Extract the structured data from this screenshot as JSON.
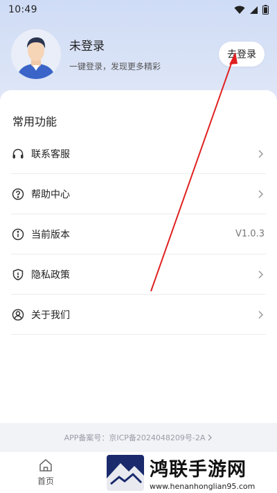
{
  "status": {
    "time": "10:49"
  },
  "profile": {
    "name": "未登录",
    "description": "一键登录，发现更多精彩",
    "login_button": "去登录"
  },
  "section_title": "常用功能",
  "menu": [
    {
      "label": "联系客服",
      "icon": "headset-icon",
      "value": ""
    },
    {
      "label": "帮助中心",
      "icon": "help-circle-icon",
      "value": ""
    },
    {
      "label": "当前版本",
      "icon": "info-icon",
      "value": "V1.0.3"
    },
    {
      "label": "隐私政策",
      "icon": "shield-icon",
      "value": ""
    },
    {
      "label": "关于我们",
      "icon": "user-circle-icon",
      "value": ""
    }
  ],
  "icp": {
    "text": "APP备案号：京ICP备2024048209号-2A"
  },
  "bottom_nav": {
    "home_label": "首页"
  },
  "watermark": {
    "title": "鸿联手游网",
    "url": "www.henanhonglian95.com"
  },
  "colors": {
    "annotation_arrow": "#e02020",
    "card_bg": "#ffffff",
    "header_bg": "#cfdcf6"
  }
}
